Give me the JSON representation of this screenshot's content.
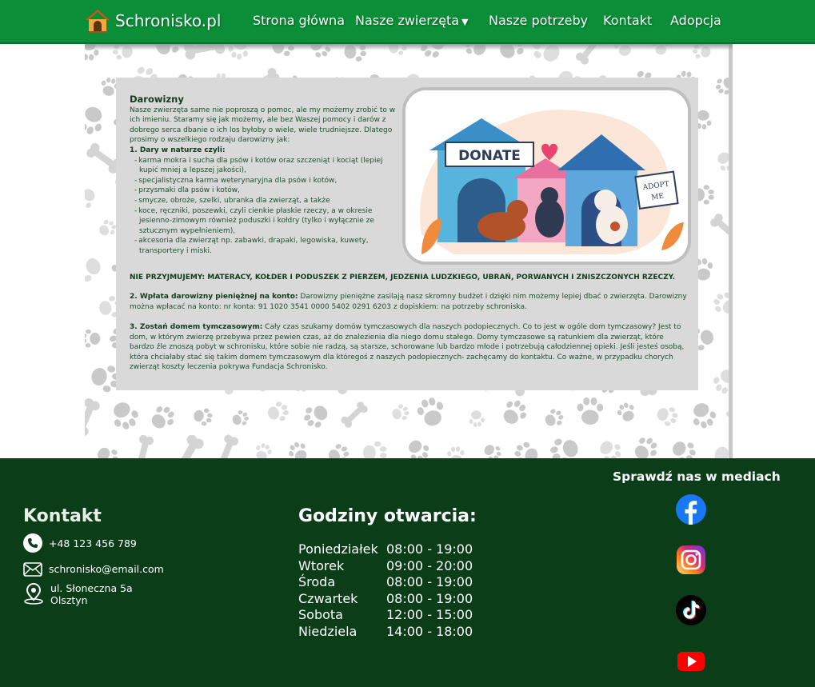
{
  "navbar": {
    "brand": "Schronisko.pl",
    "links": [
      "Strona główna",
      "Nasze zwierzęta",
      "Nasze potrzeby",
      "Kontakt",
      "Adopcja"
    ],
    "dropdown_caret": "▼"
  },
  "content": {
    "title": "Darowizny",
    "intro": "Nasze zwierzęta same nie poproszą o pomoc, ale my możemy zrobić to w ich imieniu. Staramy się jak możemy, ale bez Waszej pomocy i darów z dobrego serca dbanie o ich los byłoby o wiele, wiele trudniejsze. Dlatego prosimy o wszelkiego rodzaju darowizny jak:",
    "list_heading": "1. Dary w naturze czyli:",
    "list_items": [
      "karma mokra i sucha dla psów i kotów oraz szczeniąt i kociąt (lepiej kupić mniej a lepszej jakości),",
      "specjalistyczna karma weterynaryjna dla psów i kotów,",
      "przysmaki dla psów i kotów,",
      "smycze, obroże, szelki, ubranka dla zwierząt, a także",
      "koce, ręczniki, poszewki, czyli cienkie płaskie rzeczy, a w okresie jesienno-zimowym również poduszki i kołdry (tylko i wyłącznie ze sztucznym wypełnieniem),",
      "akcesoria dla zwierząt np. zabawki, drapaki, legowiska, kuwety, transportery i miski."
    ],
    "warning": "NIE PRZYJMUJEMY: MATERACY, KOŁDER I PODUSZEK Z PIERZEM, JEDZENIA LUDZKIEGO, UBRAŃ, PORWANYCH I ZNISZCZONYCH RZECZY.",
    "section2_heading": "2. Wpłata darowizny pieniężnej na konto:",
    "section2_text": " Darowizny pieniężne zasilają nasz skromny budżet i dzięki nim możemy lepiej dbać o zwierzęta. Darowizny można wpłacać na konto: nr konta: ",
    "section2_account": "91 1020 3541 0000 5402 0291 6203",
    "section2_suffix": " z dopiskiem: ",
    "section2_note": "na potrzeby schroniska.",
    "section3_heading": "3. Zostań domem tymczasowym:",
    "section3_text": " Cały czas szukamy domów tymczasowych dla naszych podopiecznych. Co to jest w ogóle dom tymczasowy? Jest to dom, w którym zwierzę przebywa przez pewien czas, aż do znalezienia dla niego domu stałego. Domy tymczasowe są ratunkiem dla zwierząt, które bardzo źle znoszą pobyt w schronisku, które sobie nie radzą, są starsze, schorowane lub bardzo młode i potrzebują całodziennej opieki. Jeśli jesteś osobą, która chciałaby stać się takim domem tymczasowym dla któregoś z naszych podopiecznych- zachęcamy do kontaktu. Co ważne, w przypadku chorych zwierząt koszty leczenia pokrywa Fundacja Schronisko.",
    "image_text": {
      "donate": "DONATE",
      "adopt_line1": "ADOPT",
      "adopt_line2": "ME"
    }
  },
  "footer": {
    "contact_title": "Kontakt",
    "phone": "+48 123 456 789",
    "email": "schronisko@email.com",
    "address_line1": "ul. Słoneczna 5a",
    "address_line2": "Olsztyn",
    "hours_title": "Godziny otwarcia:",
    "hours": [
      {
        "day": "Poniedziałek",
        "time": "08:00 - 19:00"
      },
      {
        "day": "Wtorek",
        "time": "09:00 - 20:00"
      },
      {
        "day": "Środa",
        "time": "08:00 - 19:00"
      },
      {
        "day": "Czwartek",
        "time": "08:00 - 19:00"
      },
      {
        "day": "Sobota",
        "time": "12:00 - 15:00"
      },
      {
        "day": "Niedziela",
        "time": "14:00 - 18:00"
      }
    ],
    "social_title": "Sprawdź nas w mediach",
    "social_icons": [
      "facebook-icon",
      "instagram-icon",
      "tiktok-icon",
      "youtube-icon"
    ]
  },
  "colors": {
    "nav_green": "#0a8f38",
    "footer_green": "#0a3d18",
    "panel_gray": "#d9d9d9",
    "text_green": "#1e4f2d"
  }
}
